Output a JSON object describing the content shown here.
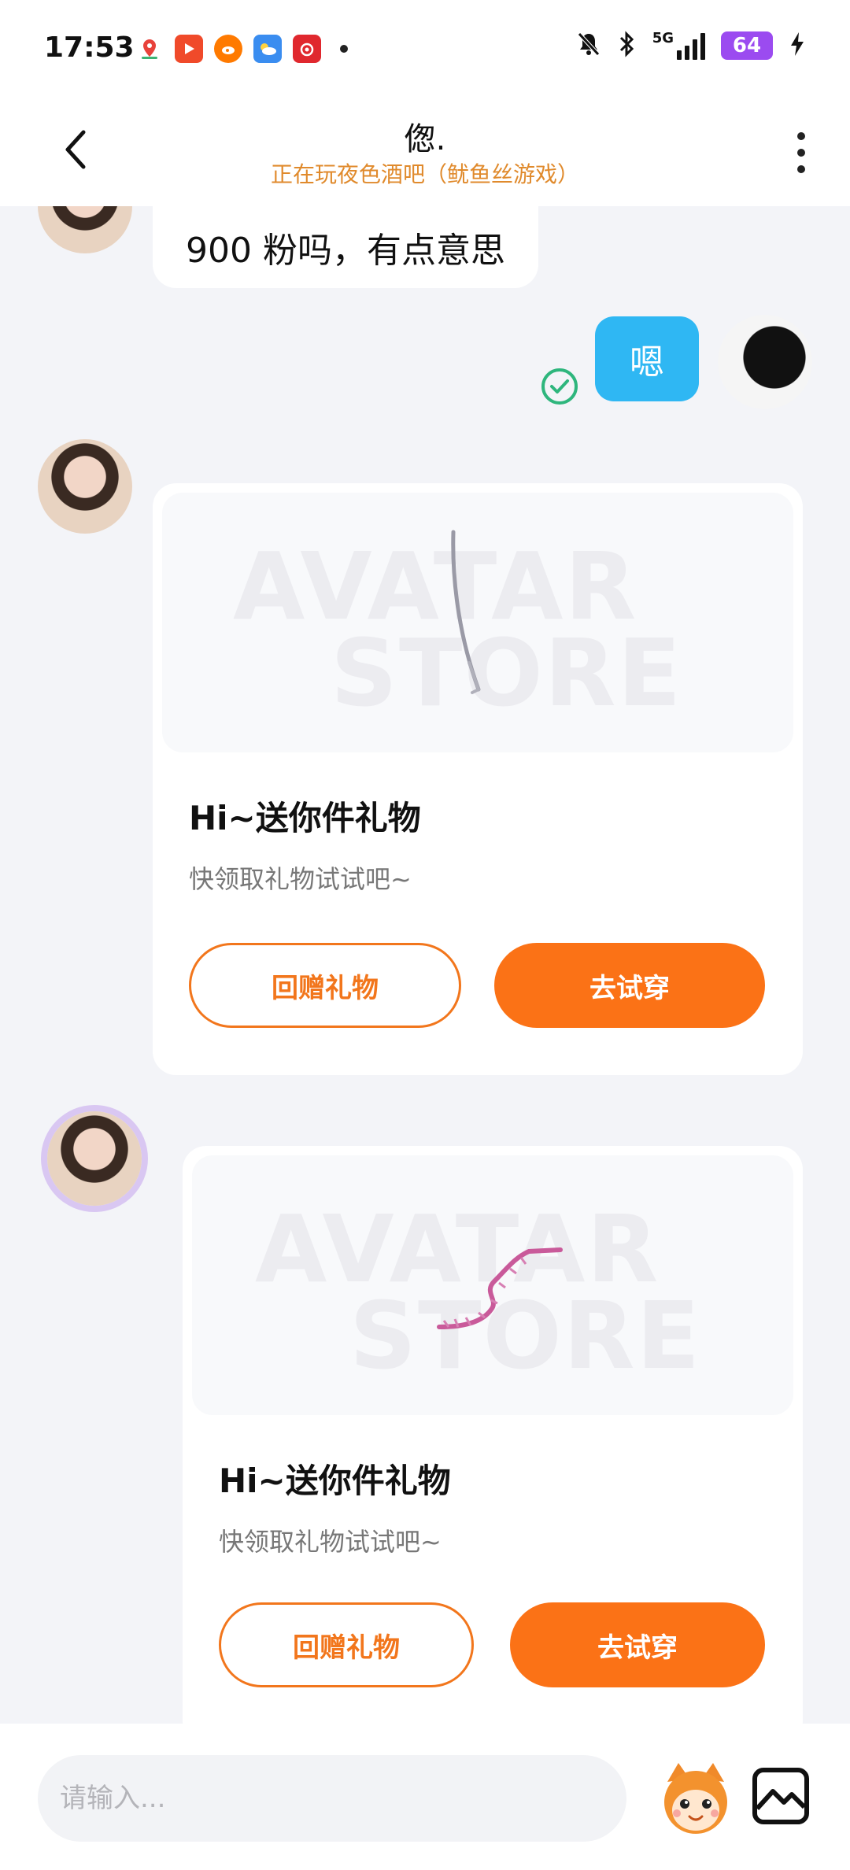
{
  "status_bar": {
    "time": "17:53",
    "network": "5G",
    "battery": "64",
    "app_icons": [
      "map-icon",
      "video-icon",
      "weibo-icon",
      "weather-icon",
      "netease-music-icon"
    ]
  },
  "header": {
    "title": "偬.",
    "subtitle": "正在玩夜色酒吧（鱿鱼丝游戏）"
  },
  "messages": {
    "incoming_text": "900 粉吗，有点意思",
    "outgoing_text": "嗯"
  },
  "gift_cards": [
    {
      "watermark_top": "AVATAR",
      "watermark_bottom": "STORE",
      "title": "Hi~送你件礼物",
      "desc": "快领取礼物试试吧~",
      "return_gift_label": "回赠礼物",
      "try_on_label": "去试穿"
    },
    {
      "watermark_top": "AVATAR",
      "watermark_bottom": "STORE",
      "title": "Hi~送你件礼物",
      "desc": "快领取礼物试试吧~",
      "return_gift_label": "回赠礼物",
      "try_on_label": "去试穿"
    }
  ],
  "input_bar": {
    "placeholder": "请输入..."
  },
  "colors": {
    "accent_orange": "#fb7216",
    "subtitle_orange": "#e08a2c",
    "bubble_blue": "#2fb7f3",
    "read_green": "#2eb67d",
    "battery_purple": "#9b4bf0"
  }
}
